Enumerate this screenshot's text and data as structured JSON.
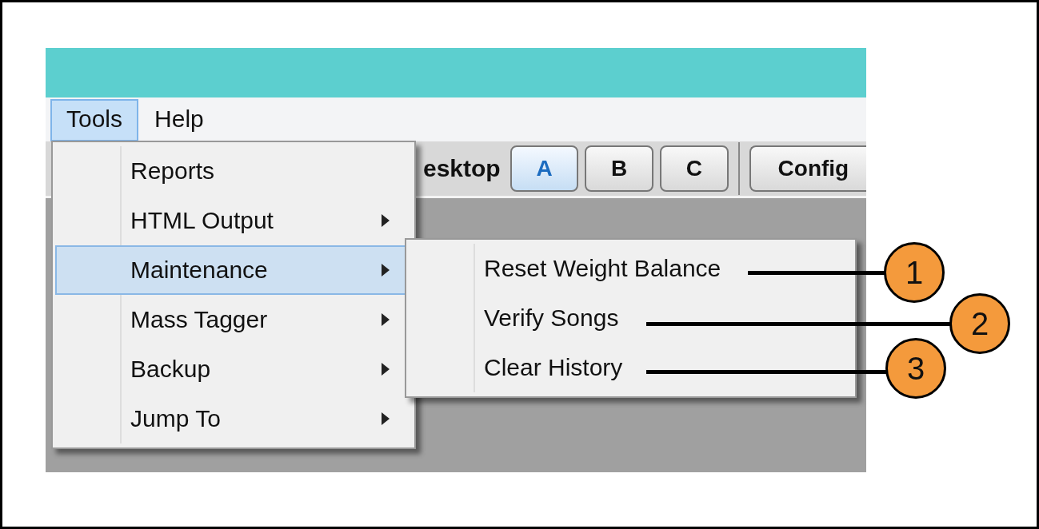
{
  "menu_bar": [
    {
      "label": "Tools",
      "selected": true
    },
    {
      "label": "Help",
      "selected": false
    }
  ],
  "toolbar": {
    "label": "esktop",
    "buttons": [
      {
        "label": "A",
        "selected": true
      },
      {
        "label": "B",
        "selected": false
      },
      {
        "label": "C",
        "selected": false
      }
    ],
    "config_button": "Config"
  },
  "menu": {
    "items": [
      {
        "label": "Reports",
        "has_submenu": false,
        "selected": false
      },
      {
        "label": "HTML Output",
        "has_submenu": true,
        "selected": false
      },
      {
        "label": "Maintenance",
        "has_submenu": true,
        "selected": true
      },
      {
        "label": "Mass Tagger",
        "has_submenu": true,
        "selected": false
      },
      {
        "label": "Backup",
        "has_submenu": true,
        "selected": false
      },
      {
        "label": "Jump To",
        "has_submenu": true,
        "selected": false
      }
    ]
  },
  "submenu": {
    "items": [
      {
        "label": "Reset Weight Balance",
        "callout": "1"
      },
      {
        "label": "Verify Songs",
        "callout": "2"
      },
      {
        "label": "Clear History",
        "callout": "3"
      }
    ]
  }
}
